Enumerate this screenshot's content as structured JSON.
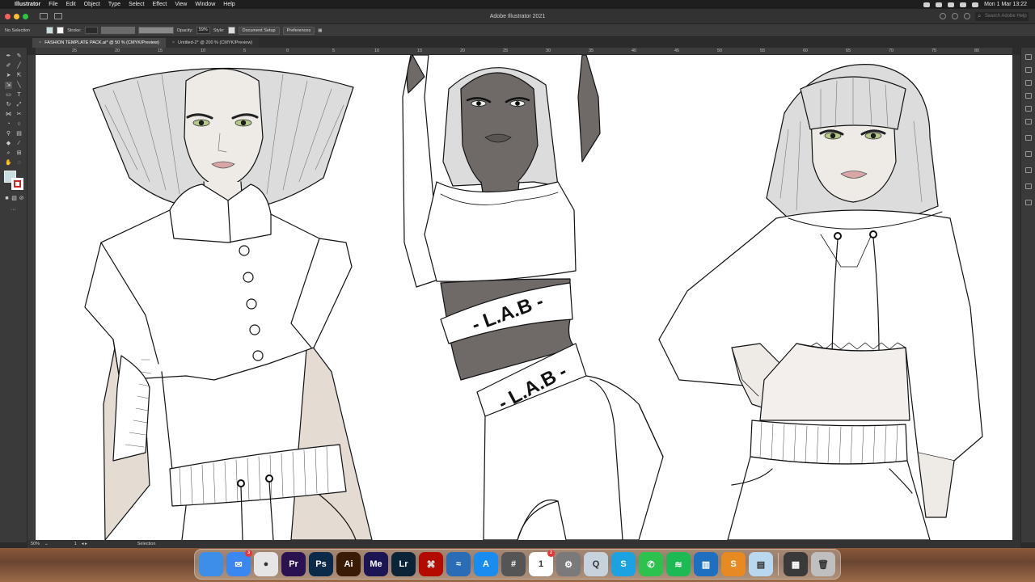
{
  "menubar": {
    "app_name": "Illustrator",
    "items": [
      "File",
      "Edit",
      "Object",
      "Type",
      "Select",
      "Effect",
      "View",
      "Window",
      "Help"
    ],
    "datetime": "Mon 1 Mar  13:22"
  },
  "window": {
    "title": "Adobe Illustrator 2021",
    "search_placeholder": "Search Adobe Help"
  },
  "control_bar": {
    "selection_status": "No Selection",
    "stroke_label": "Stroke:",
    "opacity_label": "Opacity:",
    "opacity_value": "59%",
    "style_label": "Style:",
    "document_setup": "Document Setup",
    "preferences": "Preferences"
  },
  "tabs": [
    {
      "label": "FASHION TEMPLATE PACK.ai* @ 50 % (CMYK/Preview)",
      "active": true
    },
    {
      "label": "Untitled-2* @ 200 % (CMYK/Preview)",
      "active": false
    }
  ],
  "ruler": {
    "ticks": [
      "25",
      "20",
      "15",
      "10",
      "5",
      "0",
      "5",
      "10",
      "15",
      "20",
      "25",
      "30",
      "35",
      "40",
      "45",
      "50",
      "55",
      "60",
      "65",
      "70",
      "75",
      "80"
    ]
  },
  "artwork": {
    "brand_text": "- L.A.B -"
  },
  "status": {
    "zoom": "50%",
    "artboard": "1",
    "tool": "Selection"
  },
  "colors": {
    "skin_tone_dark": "#6f6967",
    "skin_tone_light": "#eeebe7",
    "hair_gray": "#d7d7d7",
    "pants_tone": "#e4dcd3",
    "fill_swatch": "#c9dde0"
  },
  "dock": {
    "apps": [
      {
        "name": "finder-icon",
        "label": "",
        "color": "#3d8ee6"
      },
      {
        "name": "mail-icon",
        "label": "✉",
        "color": "#3b87f2",
        "badge": "3"
      },
      {
        "name": "chrome-icon",
        "label": "●",
        "color": "#e5e5e5"
      },
      {
        "name": "premiere-icon",
        "label": "Pr",
        "color": "#2a1152"
      },
      {
        "name": "photoshop-icon",
        "label": "Ps",
        "color": "#0b2a4a"
      },
      {
        "name": "illustrator-icon",
        "label": "Ai",
        "color": "#3a1c06"
      },
      {
        "name": "media-encoder-icon",
        "label": "Me",
        "color": "#1b1553"
      },
      {
        "name": "lightroom-icon",
        "label": "Lr",
        "color": "#0b2438"
      },
      {
        "name": "acrobat-icon",
        "label": "⌘",
        "color": "#b30b00"
      },
      {
        "name": "wave-app-icon",
        "label": "≈",
        "color": "#2a6cb5"
      },
      {
        "name": "app-store-icon",
        "label": "A",
        "color": "#1a8cf0"
      },
      {
        "name": "calculator-icon",
        "label": "#",
        "color": "#555555"
      },
      {
        "name": "calendar-icon",
        "label": "1",
        "color": "#ffffff",
        "badge": "2"
      },
      {
        "name": "system-preferences-icon",
        "label": "⚙",
        "color": "#7a7a7a"
      },
      {
        "name": "quicktime-icon",
        "label": "Q",
        "color": "#c6d3dc"
      },
      {
        "name": "skype-icon",
        "label": "S",
        "color": "#1aa3e0"
      },
      {
        "name": "whatsapp-icon",
        "label": "✆",
        "color": "#2dc24e"
      },
      {
        "name": "spotify-icon",
        "label": "≋",
        "color": "#1db954"
      },
      {
        "name": "trello-icon",
        "label": "▥",
        "color": "#1f6fc1"
      },
      {
        "name": "sublime-icon",
        "label": "S",
        "color": "#e68a21"
      },
      {
        "name": "preview-icon",
        "label": "▤",
        "color": "#b9d7ee"
      }
    ],
    "docs": [
      {
        "name": "downloads-stack-icon",
        "label": "▦",
        "color": "#3a3a3a"
      },
      {
        "name": "trash-icon",
        "label": "🗑",
        "color": "#bfbfbf"
      }
    ]
  }
}
